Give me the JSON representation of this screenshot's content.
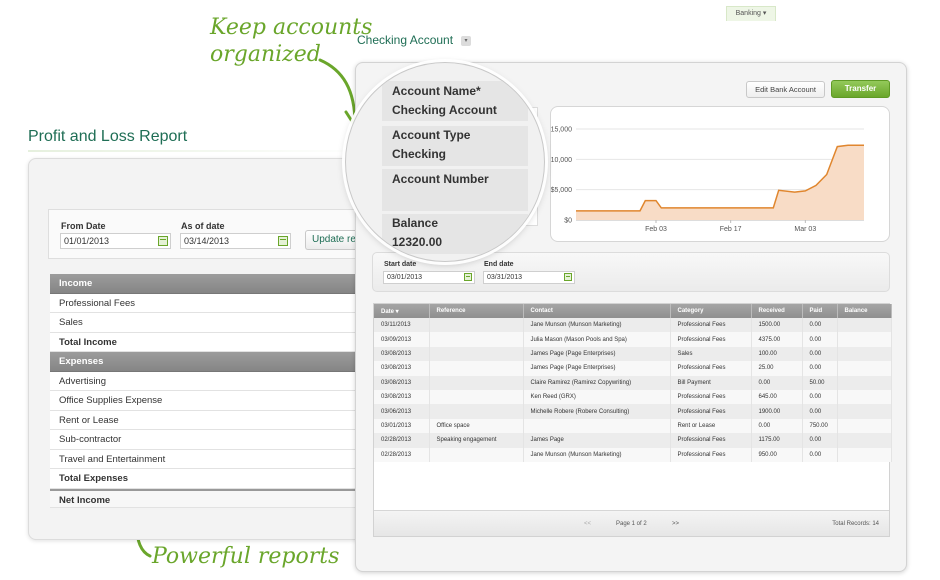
{
  "annotations": {
    "top_line1": "Keep accounts",
    "top_line2": "organized",
    "bottom": "Powerful reports"
  },
  "pl": {
    "title": "Profit and Loss Report",
    "from_label": "From Date",
    "from_value": "01/01/2013",
    "asof_label": "As of date",
    "asof_value": "03/14/2013",
    "update_label": "Update re",
    "rows": [
      {
        "label": "Income",
        "kind": "head"
      },
      {
        "label": "Professional Fees",
        "kind": "item"
      },
      {
        "label": "Sales",
        "kind": "item"
      },
      {
        "label": "Total Income",
        "kind": "total"
      },
      {
        "label": "Expenses",
        "kind": "head"
      },
      {
        "label": "Advertising",
        "kind": "item"
      },
      {
        "label": "Office Supplies Expense",
        "kind": "item"
      },
      {
        "label": "Rent or Lease",
        "kind": "item"
      },
      {
        "label": "Sub-contractor",
        "kind": "item"
      },
      {
        "label": "Travel and Entertainment",
        "kind": "item"
      },
      {
        "label": "Total Expenses",
        "kind": "total"
      },
      {
        "label": "Net Income",
        "kind": "net"
      }
    ]
  },
  "banking": {
    "tab_label": "Banking",
    "tab_caret": "▾",
    "title": "Checking Account",
    "title_caret": "▾",
    "edit_label": "Edit Bank Account",
    "transfer_label": "Transfer"
  },
  "account": {
    "name_label": "Account Name*",
    "name_value": "Checking Account",
    "type_label": "Account Type",
    "type_value": "Checking",
    "number_label": "Account Number",
    "number_value": "",
    "balance_label": "Balance",
    "balance_value": "12320.00"
  },
  "chart_data": {
    "type": "area",
    "title": "",
    "xlabel": "",
    "ylabel": "",
    "y_ticks": [
      "$15,000",
      "$10,000",
      "$5,000",
      "$0"
    ],
    "y_tick_values": [
      15000,
      10000,
      5000,
      0
    ],
    "ylim": [
      0,
      15000
    ],
    "x_ticks": [
      "Feb 03",
      "Feb 17",
      "Mar 03"
    ],
    "x_tick_values": [
      "2013-02-03",
      "2013-02-17",
      "2013-03-03"
    ],
    "x_range": [
      "2013-01-19",
      "2013-03-14"
    ],
    "grid": true,
    "color": "#e0862e",
    "fill": "#f8dcc6",
    "series": [
      {
        "x": [
          "2013-01-19",
          "2013-01-31",
          "2013-02-01",
          "2013-02-03",
          "2013-02-04",
          "2013-02-25",
          "2013-02-26",
          "2013-03-01",
          "2013-03-03",
          "2013-03-05",
          "2013-03-07",
          "2013-03-09",
          "2013-03-11",
          "2013-03-14"
        ],
        "y": [
          1500,
          1500,
          3200,
          3200,
          2000,
          2000,
          4900,
          4600,
          4800,
          5700,
          7500,
          12100,
          12320,
          12320
        ]
      }
    ]
  },
  "filter": {
    "start_label": "Start date",
    "start_value": "03/01/2013",
    "end_label": "End date",
    "end_value": "03/31/2013"
  },
  "grid": {
    "columns": [
      "Date ▾",
      "Reference",
      "Contact",
      "Category",
      "Received",
      "Paid",
      "Balance"
    ],
    "rows": [
      [
        "03/11/2013",
        "",
        "Jane Munson (Munson Marketing)",
        "Professional Fees",
        "1500.00",
        "0.00",
        ""
      ],
      [
        "03/09/2013",
        "",
        "Julia Mason (Mason Pools and Spa)",
        "Professional Fees",
        "4375.00",
        "0.00",
        ""
      ],
      [
        "03/08/2013",
        "",
        "James Page (Page Enterprises)",
        "Sales",
        "100.00",
        "0.00",
        ""
      ],
      [
        "03/08/2013",
        "",
        "James Page (Page Enterprises)",
        "Professional Fees",
        "25.00",
        "0.00",
        ""
      ],
      [
        "03/08/2013",
        "",
        "Claire Ramirez (Ramirez Copywriting)",
        "Bill Payment",
        "0.00",
        "50.00",
        ""
      ],
      [
        "03/08/2013",
        "",
        "Ken Reed (GRX)",
        "Professional Fees",
        "645.00",
        "0.00",
        ""
      ],
      [
        "03/06/2013",
        "",
        "Michelle Robere (Robere Consulting)",
        "Professional Fees",
        "1900.00",
        "0.00",
        ""
      ],
      [
        "03/01/2013",
        "Office space",
        "",
        "Rent or Lease",
        "0.00",
        "750.00",
        ""
      ],
      [
        "02/28/2013",
        "Speaking engagement",
        "James Page",
        "Professional Fees",
        "1175.00",
        "0.00",
        ""
      ],
      [
        "02/28/2013",
        "",
        "Jane Munson (Munson Marketing)",
        "Professional Fees",
        "950.00",
        "0.00",
        ""
      ]
    ],
    "pager": {
      "prev": "<<",
      "page_text": "Page 1 of 2",
      "next": ">>",
      "total_text": "Total Records: 14"
    }
  }
}
